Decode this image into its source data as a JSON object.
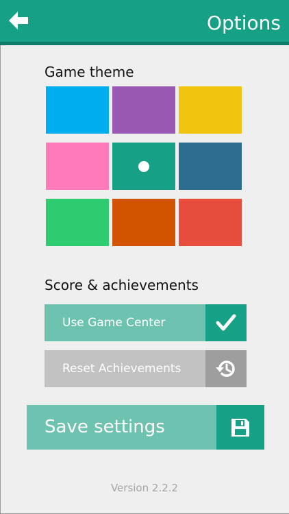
{
  "header": {
    "title": "Options",
    "back_icon": "back-arrow-icon"
  },
  "theme": {
    "title": "Game theme",
    "swatches": [
      {
        "color": "#00aeef",
        "selected": false
      },
      {
        "color": "#9b59b6",
        "selected": false
      },
      {
        "color": "#f1c40f",
        "selected": false
      },
      {
        "color": "#ff7ab8",
        "selected": false
      },
      {
        "color": "#16a085",
        "selected": true
      },
      {
        "color": "#2c6d8f",
        "selected": false
      },
      {
        "color": "#2ecc71",
        "selected": false
      },
      {
        "color": "#d35400",
        "selected": false
      },
      {
        "color": "#e74c3c",
        "selected": false
      }
    ]
  },
  "score": {
    "title": "Score & achievements",
    "game_center": {
      "label": "Use Game Center",
      "checked": true,
      "icon": "checkmark-icon",
      "label_color": "#6ec2b0",
      "icon_color": "#16a085"
    },
    "reset": {
      "label": "Reset Achievements",
      "icon": "history-icon",
      "label_color": "#c2c2c2",
      "icon_color": "#9e9e9e"
    }
  },
  "save": {
    "label": "Save settings",
    "icon": "floppy-disk-icon"
  },
  "version": "Version 2.2.2"
}
